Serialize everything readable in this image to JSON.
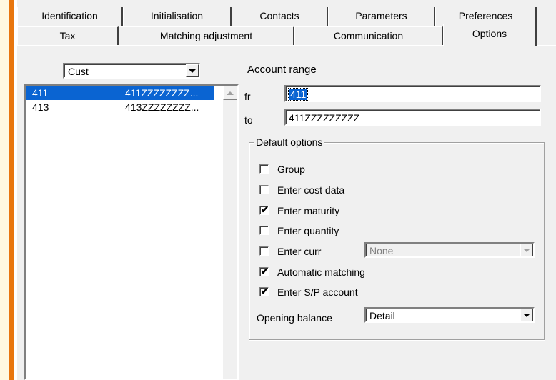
{
  "tabs_row1": [
    "Identification",
    "Initialisation",
    "Contacts",
    "Parameters",
    "Preferences"
  ],
  "tabs_row2": [
    "Tax",
    "Matching adjustment",
    "Communication",
    "Options"
  ],
  "active_tab": "Options",
  "type_select": {
    "value": "Cust"
  },
  "account_list": [
    {
      "code": "411",
      "range": "411ZZZZZZZZ...",
      "selected": true
    },
    {
      "code": "413",
      "range": "413ZZZZZZZZ...",
      "selected": false
    }
  ],
  "account_range": {
    "title": "Account range",
    "from_label": "fr",
    "from_value": "411",
    "to_label": "to",
    "to_value": "411ZZZZZZZZZ"
  },
  "default_options": {
    "title": "Default options",
    "checkboxes": [
      {
        "label": "Group",
        "checked": false
      },
      {
        "label": "Enter cost data",
        "checked": false
      },
      {
        "label": "Enter maturity",
        "checked": true
      },
      {
        "label": "Enter quantity",
        "checked": false
      },
      {
        "label": "Enter curr",
        "checked": false
      },
      {
        "label": "Automatic matching",
        "checked": true
      },
      {
        "label": "Enter S/P account",
        "checked": true
      }
    ],
    "currency_select": {
      "value": "None",
      "disabled": true
    },
    "opening_balance": {
      "label": "Opening balance",
      "value": "Detail"
    }
  },
  "colors": {
    "selection": "#0a64d2",
    "accent_strip": "#e8760e",
    "background": "#f0f0f0"
  }
}
